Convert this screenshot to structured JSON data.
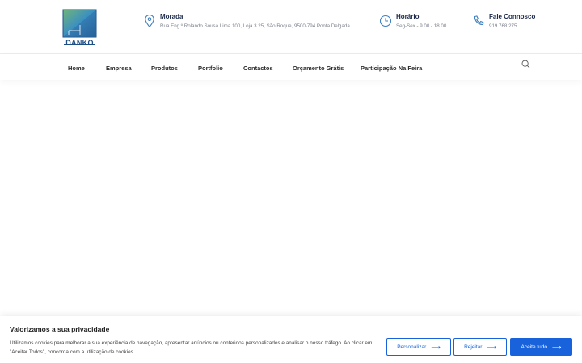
{
  "brand": {
    "logo_text": "DANKO",
    "primary_color": "#1863dc",
    "logo_color": "#1d4f86"
  },
  "header": {
    "address": {
      "title": "Morada",
      "value": "Rua Eng.º Rolando Sousa Lima 100, Loja 3.25, São Roque, 9500-794 Ponta Delgada",
      "icon": "map-pin-icon"
    },
    "hours": {
      "title": "Horário",
      "value": "Seg-Sex - 9.00 - 18.00",
      "icon": "clock-icon"
    },
    "contact": {
      "title": "Fale Connosco",
      "value": "919 768 275",
      "icon": "phone-icon"
    }
  },
  "nav": {
    "items": [
      {
        "label": "Home"
      },
      {
        "label": "Empresa"
      },
      {
        "label": "Produtos"
      },
      {
        "label": "Portfolio"
      },
      {
        "label": "Contactos"
      },
      {
        "label": "Orçamento Grátis"
      },
      {
        "label": "Participação Na Feira"
      }
    ],
    "search_icon": "search-icon"
  },
  "cookie_banner": {
    "title": "Valorizamos a sua privacidade",
    "text": "Utilizamos cookies para melhorar a sua experiência de navegação, apresentar anúncios ou conteúdos personalizados e analisar o nosso tráfego. Ao clicar em \"Aceitar Todos\", concorda com a utilização de cookies.",
    "customize_label": "Personalizar",
    "reject_label": "Rejeitar",
    "accept_label": "Aceite tudo"
  }
}
